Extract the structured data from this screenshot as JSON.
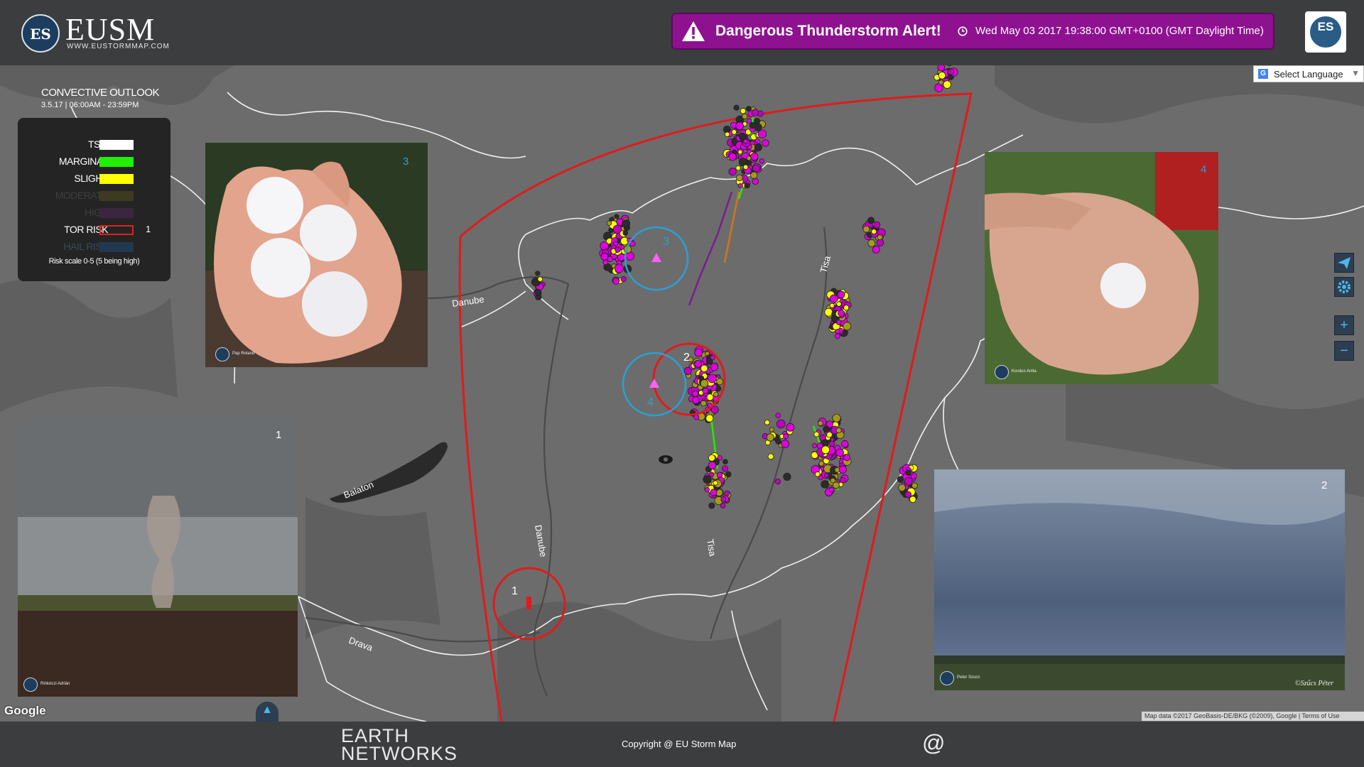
{
  "header": {
    "logo_badge": "ES",
    "logo_title": "EUSM",
    "logo_subtitle": "WWW.EUSTORMMAP.COM",
    "alert_title": "Dangerous Thunderstorm Alert!",
    "alert_time": "Wed May 03 2017 19:38:00 GMT+0100 (GMT Daylight Time)",
    "alert_color": "#8e1290"
  },
  "language": {
    "label": "Select Language",
    "icon": "google-translate-icon"
  },
  "outlook": {
    "title": "CONVECTIVE OUTLOOK",
    "date": "3.5.17 | 06:00AM - 23:59PM"
  },
  "legend": {
    "rows": [
      {
        "label": "TSM",
        "color": "#ffffff",
        "value": ""
      },
      {
        "label": "MARGINAL",
        "color": "#22ee00",
        "value": ""
      },
      {
        "label": "SLIGHT",
        "color": "#ffff00",
        "value": ""
      },
      {
        "label": "MODERATE",
        "color": "#3e3a22",
        "value": ""
      },
      {
        "label": "HIGH",
        "color": "#3b2640",
        "value": ""
      },
      {
        "label": "TOR RISK",
        "color": "#e02020",
        "value": "1"
      },
      {
        "label": "HAIL RISK",
        "color": "#21394e",
        "value": ""
      }
    ],
    "note": "Risk scale 0-5 (5 being high)"
  },
  "map": {
    "labels": {
      "danube_1": "Danube",
      "danube_2": "Danube",
      "balaton": "Balaton",
      "tisa_1": "Tisa",
      "tisa_2": "Tisa",
      "drava": "Drava"
    },
    "markers": [
      {
        "id": "1",
        "kind": "tornado-risk"
      },
      {
        "id": "2",
        "kind": "tornado-risk"
      },
      {
        "id": "3",
        "kind": "hail-report"
      },
      {
        "id": "4",
        "kind": "hail-report"
      }
    ]
  },
  "photos": [
    {
      "number": "3",
      "subject": "hailstones in hand",
      "credit": "Pap Roland"
    },
    {
      "number": "4",
      "subject": "hailstone in palm",
      "credit": "Kovács Anita"
    },
    {
      "number": "1",
      "subject": "tornado over field",
      "credit": "Rinkóczi Adrián"
    },
    {
      "number": "2",
      "subject": "supercell over plain",
      "credit": "Peter Szucs",
      "watermark": "©Szűcs Péter"
    }
  ],
  "controls": {
    "share": "paper-plane-icon",
    "settings": "gear-icon",
    "zoom_in": "+",
    "zoom_out": "−"
  },
  "map_footer": {
    "google": "Google",
    "attribution": "Map data ©2017 GeoBasis-DE/BKG (©2009), Google  |  Terms of Use"
  },
  "footer": {
    "earth_line1": "EARTH",
    "earth_line2": "NETWORKS",
    "copyright": "Copyright @ EU Storm Map",
    "contact_icon": "@"
  }
}
